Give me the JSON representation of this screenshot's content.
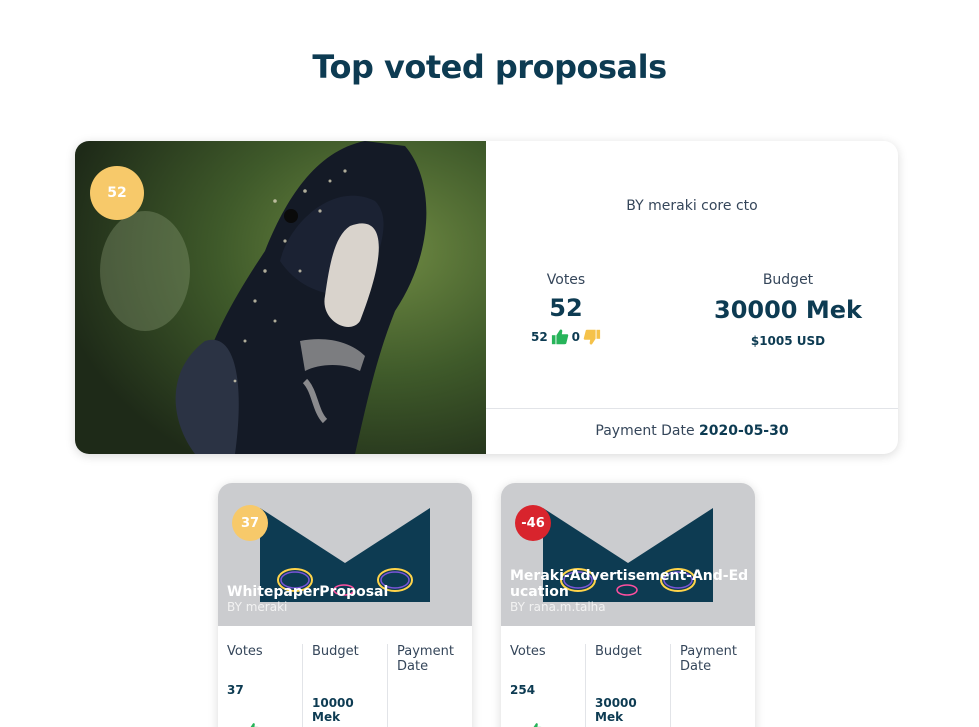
{
  "page": {
    "title": "Top voted proposals"
  },
  "featured": {
    "score": "52",
    "author": "BY meraki core cto",
    "votes_label": "Votes",
    "votes_total": "52",
    "upvotes": "52",
    "downvotes": "0",
    "budget_label": "Budget",
    "budget": "30000 Mek",
    "budget_usd": "$1005 USD",
    "payment_label": "Payment Date",
    "payment_date": "2020-05-30",
    "icons": {
      "up": "thumbs-up-icon",
      "down": "thumbs-down-icon"
    },
    "colors": {
      "badge": "#f7c96a",
      "up": "#27b45a",
      "down": "#f5c24a"
    }
  },
  "cards": [
    {
      "score": "37",
      "title": "WhitepaperProposal",
      "author": "BY meraki",
      "votes_label": "Votes",
      "votes": "37",
      "budget_label": "Budget",
      "budget": "10000 Mek",
      "payment_label": "Payment Date",
      "badge_color": "#f7c96a"
    },
    {
      "score": "-46",
      "title": "Meraki-Advertisement-And-Education",
      "author": "BY rana.m.talha",
      "votes_label": "Votes",
      "votes": "254",
      "budget_label": "Budget",
      "budget": "30000 Mek",
      "payment_label": "Payment Date",
      "badge_color": "#d8242d"
    }
  ]
}
